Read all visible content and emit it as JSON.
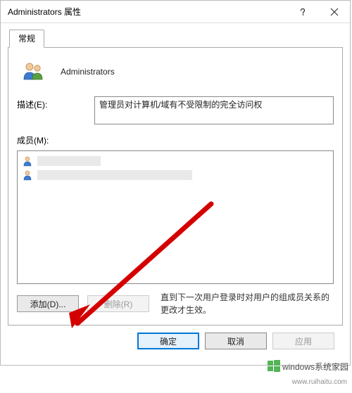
{
  "titlebar": {
    "title": "Administrators 属性"
  },
  "tabs": {
    "general_label": "常规"
  },
  "header": {
    "group_name": "Administrators"
  },
  "form": {
    "description_label": "描述(E):",
    "description_value": "管理员对计算机/域有不受限制的完全访问权",
    "members_label": "成员(M):"
  },
  "buttons": {
    "add_label": "添加(D)...",
    "remove_label": "删除(R)",
    "ok_label": "确定",
    "cancel_label": "取消",
    "apply_label": "应用"
  },
  "note": "直到下一次用户登录时对用户的组成员关系的更改才生效。",
  "watermark": {
    "brand": "windows系统家园",
    "url": "www.ruihaitu.com"
  }
}
